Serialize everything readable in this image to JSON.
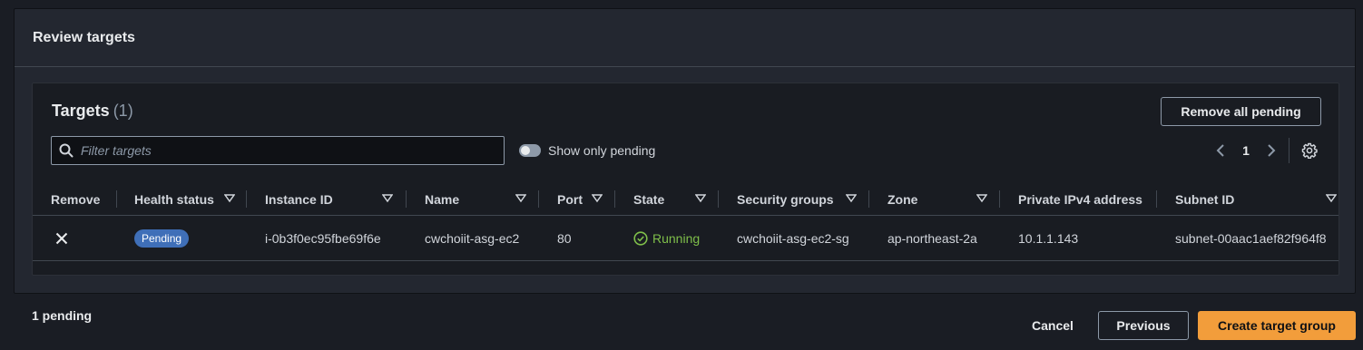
{
  "panel": {
    "title": "Review targets"
  },
  "targets": {
    "title": "Targets",
    "count": "(1)",
    "remove_all_label": "Remove all pending",
    "filter_placeholder": "Filter targets",
    "toggle_label": "Show only pending",
    "page": "1"
  },
  "table": {
    "columns": [
      "Remove",
      "Health status",
      "Instance ID",
      "Name",
      "Port",
      "State",
      "Security groups",
      "Zone",
      "Private IPv4 address",
      "Subnet ID"
    ],
    "rows": [
      {
        "health_status": "Pending",
        "instance_id": "i-0b3f0ec95fbe69f6e",
        "name": "cwchoiit-asg-ec2",
        "port": "80",
        "state": "Running",
        "security_groups": "cwchoiit-asg-ec2-sg",
        "zone": "ap-northeast-2a",
        "private_ipv4": "10.1.1.143",
        "subnet_id": "subnet-00aac1aef82f964f8"
      }
    ]
  },
  "footer": {
    "pending_text": "1 pending",
    "cancel_label": "Cancel",
    "previous_label": "Previous",
    "create_label": "Create target group"
  },
  "colors": {
    "background": "#1a1d24",
    "panel": "#232730",
    "primary_button": "#f29d3b",
    "pending_badge": "#3f6fb8",
    "running": "#7fbf4a"
  }
}
